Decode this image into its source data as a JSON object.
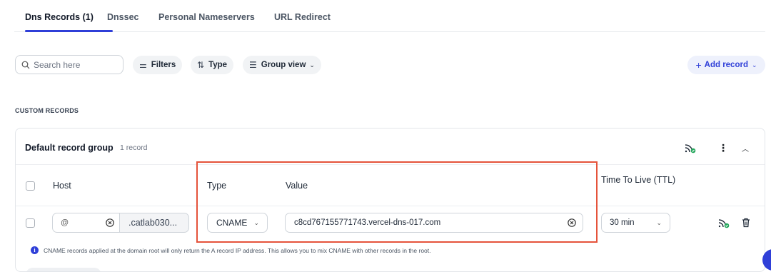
{
  "tabs": [
    {
      "label": "Dns Records (1)",
      "active": true
    },
    {
      "label": "Dnssec"
    },
    {
      "label": "Personal Nameservers"
    },
    {
      "label": "URL Redirect"
    }
  ],
  "toolbar": {
    "search_placeholder": "Search here",
    "filters_label": "Filters",
    "type_label": "Type",
    "group_view_label": "Group view",
    "add_record_label": "Add record"
  },
  "section_label": "CUSTOM RECORDS",
  "group": {
    "title": "Default record group",
    "count": "1 record"
  },
  "table": {
    "headers": {
      "host": "Host",
      "type": "Type",
      "value": "Value",
      "ttl": "Time To Live (TTL)"
    },
    "row": {
      "host_prefix": "@",
      "host_suffix": ".catlab030...",
      "type": "CNAME",
      "value": "c8cd767155771743.vercel-dns-017.com",
      "ttl": "30 min"
    }
  },
  "info_text": "CNAME records applied at the domain root will only return the A record IP address. This allows you to mix CNAME with other records in the root.",
  "colors": {
    "accent": "#2f3fd8",
    "highlight_border": "#e5533b",
    "status_green": "#22a65a"
  },
  "icons": [
    "search-icon",
    "filters-icon",
    "sort-icon",
    "list-icon",
    "plus-icon",
    "chevron-down-icon",
    "status-feed-icon",
    "more-icon",
    "chevron-up-icon",
    "clear-icon",
    "delete-icon",
    "info-icon"
  ]
}
